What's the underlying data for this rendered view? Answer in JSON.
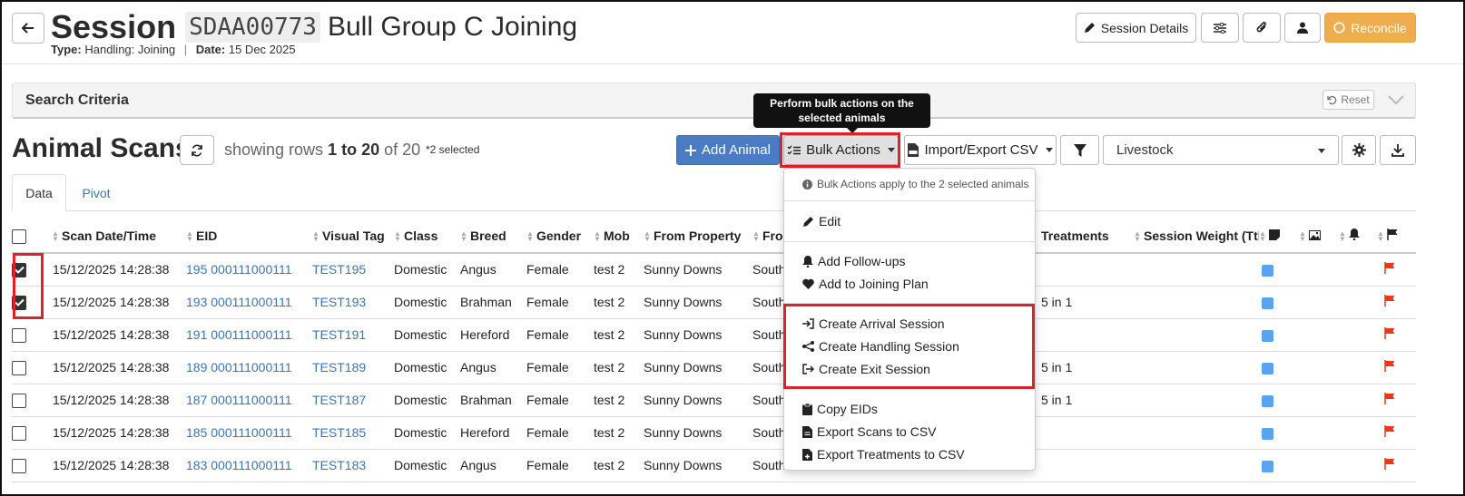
{
  "header": {
    "title_word": "Session",
    "session_code": "SDAA00773",
    "session_name": "Bull Group C Joining",
    "type_label": "Type:",
    "type_value": "Handling: Joining",
    "separator": "|",
    "date_label": "Date:",
    "date_value": "15 Dec 2025",
    "session_details_label": "Session Details",
    "reconcile_label": "Reconcile"
  },
  "search_panel": {
    "label": "Search Criteria",
    "reset_label": "Reset"
  },
  "tooltip": "Perform bulk actions on the selected animals",
  "scans": {
    "title": "Animal Scans",
    "rows_prefix": "showing rows",
    "rows_range": "1 to 20",
    "rows_suffix": "of 20",
    "selected_note": "*2 selected"
  },
  "toolbar": {
    "add_animal_label": "Add Animal",
    "bulk_actions_label": "Bulk Actions",
    "import_export_label": "Import/Export CSV",
    "livestock_value": "Livestock"
  },
  "tabs": [
    {
      "label": "Data"
    },
    {
      "label": "Pivot"
    }
  ],
  "table": {
    "headers": [
      "Scan Date/Time",
      "EID",
      "Visual Tag",
      "Class",
      "Breed",
      "Gender",
      "Mob",
      "From Property",
      "Fro",
      "Treatments",
      "Session Weight (Ttl)"
    ],
    "rows": [
      {
        "checked": true,
        "date": "15/12/2025 14:28:38",
        "eid": "195 000111000111",
        "tag": "TEST195",
        "class": "Domestic",
        "breed": "Angus",
        "gender": "Female",
        "mob": "test 2",
        "from_property": "Sunny Downs",
        "fro": "South",
        "treatments": ""
      },
      {
        "checked": true,
        "date": "15/12/2025 14:28:38",
        "eid": "193 000111000111",
        "tag": "TEST193",
        "class": "Domestic",
        "breed": "Brahman",
        "gender": "Female",
        "mob": "test 2",
        "from_property": "Sunny Downs",
        "fro": "South",
        "treatments": "5 in 1"
      },
      {
        "checked": false,
        "date": "15/12/2025 14:28:38",
        "eid": "191 000111000111",
        "tag": "TEST191",
        "class": "Domestic",
        "breed": "Hereford",
        "gender": "Female",
        "mob": "test 2",
        "from_property": "Sunny Downs",
        "fro": "South",
        "treatments": ""
      },
      {
        "checked": false,
        "date": "15/12/2025 14:28:38",
        "eid": "189 000111000111",
        "tag": "TEST189",
        "class": "Domestic",
        "breed": "Angus",
        "gender": "Female",
        "mob": "test 2",
        "from_property": "Sunny Downs",
        "fro": "South",
        "treatments": "5 in 1"
      },
      {
        "checked": false,
        "date": "15/12/2025 14:28:38",
        "eid": "187 000111000111",
        "tag": "TEST187",
        "class": "Domestic",
        "breed": "Brahman",
        "gender": "Female",
        "mob": "test 2",
        "from_property": "Sunny Downs",
        "fro": "South",
        "treatments": "5 in 1"
      },
      {
        "checked": false,
        "date": "15/12/2025 14:28:38",
        "eid": "185 000111000111",
        "tag": "TEST185",
        "class": "Domestic",
        "breed": "Hereford",
        "gender": "Female",
        "mob": "test 2",
        "from_property": "Sunny Downs",
        "fro": "South",
        "treatments": ""
      },
      {
        "checked": false,
        "date": "15/12/2025 14:28:38",
        "eid": "183 000111000111",
        "tag": "TEST183",
        "class": "Domestic",
        "breed": "Angus",
        "gender": "Female",
        "mob": "test 2",
        "from_property": "Sunny Downs",
        "fro": "South",
        "treatments": ""
      }
    ]
  },
  "bulk_menu": {
    "info": "Bulk Actions apply to the 2 selected animals",
    "edit": "Edit",
    "add_follow_ups": "Add Follow-ups",
    "add_to_joining_plan": "Add to Joining Plan",
    "create_arrival_session": "Create Arrival Session",
    "create_handling_session": "Create Handling Session",
    "create_exit_session": "Create Exit Session",
    "copy_eids": "Copy EIDs",
    "export_scans": "Export Scans to CSV",
    "export_treatments": "Export Treatments to CSV"
  },
  "colors": {
    "accent_blue": "#4a7cc5",
    "link_blue": "#3b74b8",
    "reconcile_orange": "#f0ad4e",
    "highlight_red": "#e0202a",
    "flag_red": "#e8391e"
  }
}
